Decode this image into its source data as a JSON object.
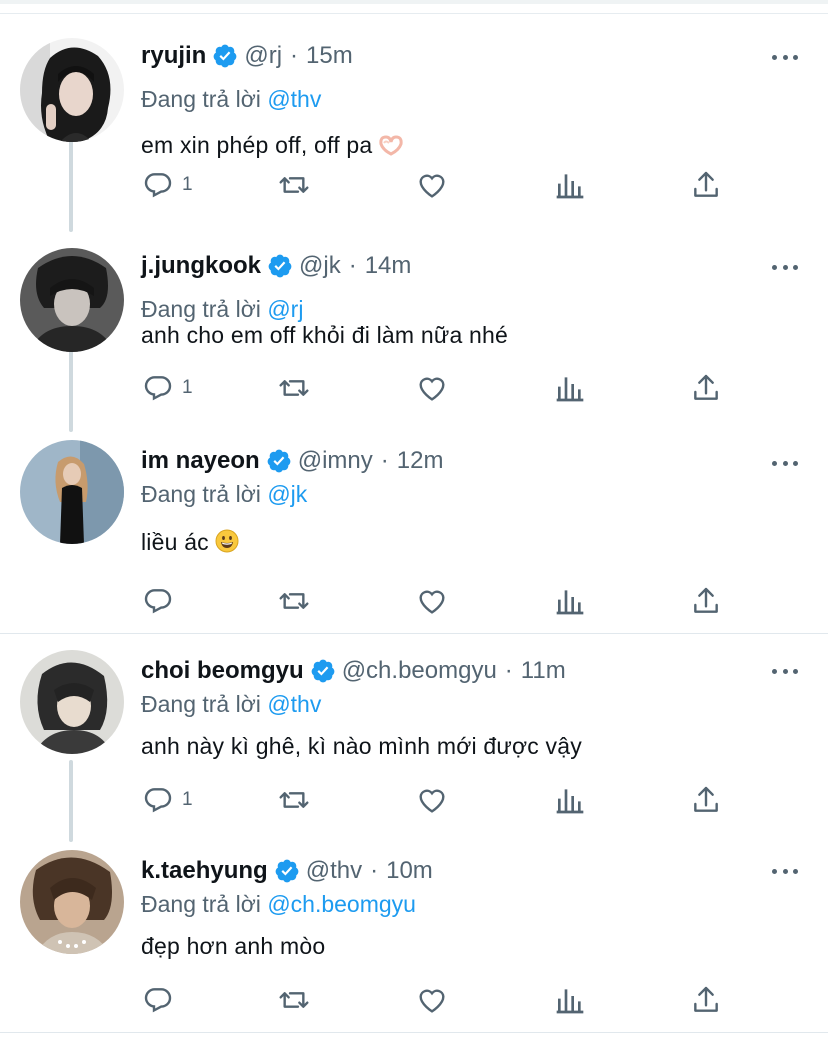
{
  "colors": {
    "text": "#0f1419",
    "muted": "#536471",
    "link": "#1d9bf0",
    "verified": "#1d9bf0",
    "divider": "#e1e8ed",
    "thread_line": "#cfd9de"
  },
  "reply_prefix": "Đang trả lời",
  "tweets": [
    {
      "name": "ryujin",
      "handle": "@rj",
      "time": "15m",
      "reply_to": "@thv",
      "text": "em xin phép off, off pa",
      "text_emoji": "heart-hands-emoji",
      "reply_count": "1",
      "avatar": "ryujin-avatar"
    },
    {
      "name": "j.jungkook",
      "handle": "@jk",
      "time": "14m",
      "reply_to": "@rj",
      "text": "anh cho em off khỏi đi làm nữa nhé",
      "reply_count": "1",
      "avatar": "jungkook-avatar"
    },
    {
      "name": "im nayeon",
      "handle": "@imny",
      "time": "12m",
      "reply_to": "@jk",
      "text": "liều ác",
      "text_emoji": "grinning-face-emoji",
      "reply_count": "",
      "avatar": "nayeon-avatar"
    },
    {
      "name": "choi beomgyu",
      "handle": "@ch.beomgyu",
      "time": "11m",
      "reply_to": "@thv",
      "text": "anh này kì ghê, kì nào mình mới được vậy",
      "reply_count": "1",
      "avatar": "beomgyu-avatar"
    },
    {
      "name": "k.taehyung",
      "handle": "@thv",
      "time": "10m",
      "reply_to": "@ch.beomgyu",
      "text": "đẹp hơn anh mòo",
      "reply_count": "",
      "avatar": "taehyung-avatar"
    }
  ],
  "icons": {
    "verified": "verified-badge-icon",
    "more": "more-options-icon",
    "reply": "reply-icon",
    "retweet": "retweet-icon",
    "like": "like-icon",
    "views": "views-icon",
    "share": "share-icon"
  }
}
